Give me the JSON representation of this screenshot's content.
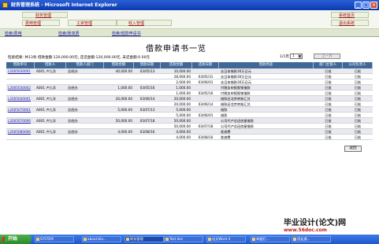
{
  "window": {
    "title": "财务管理系统 - Microsoft Internet Explorer"
  },
  "nav": {
    "row1": [
      "财务管理",
      "工资管理",
      "收入管理",
      "系统首页"
    ],
    "row2": [
      "费用管理",
      "退出系统"
    ]
  },
  "crumbs": [
    "检索/费用",
    "检索/账单费",
    "检索/借款申请书"
  ],
  "page_title": "借款申请书一览",
  "summary": "检索结果: 共13条  借款金额:120,000.00元, 还还金额:120,000.00元, 未还金额:0.00元",
  "pager": {
    "label": "1/1页",
    "selected": "1",
    "button": "上一页"
  },
  "table": {
    "headers": [
      "借款单号",
      "借款人",
      "借款人部门",
      "借款金额",
      "借款日期",
      "还款金额",
      "还款日期",
      "借款用途",
      "部门主管人",
      "公司负责人"
    ],
    "rows": [
      [
        "L2005030001",
        "A001 卢九洋",
        "总经办",
        "40,000.00",
        "03/05/13",
        "10,000.00",
        "",
        "去日本借款30万日元",
        "已批",
        "已批"
      ],
      [
        "",
        "",
        "",
        "",
        "",
        "28,000.00",
        "03/05/31",
        "去日本借款30万日元",
        "已批",
        "已批"
      ],
      [
        "",
        "",
        "",
        "",
        "",
        "2,000.00",
        "03/06/01",
        "去日本借款30万日元",
        "已批",
        "已批"
      ],
      [
        "L2005030002",
        "A001 卢九洋",
        "总经办",
        "1,000.00",
        "03/05/16",
        "1,000.00",
        "",
        "付税务申报报销借款",
        "已批",
        "已批"
      ],
      [
        "",
        "",
        "",
        "",
        "",
        "1,000.00",
        "03/05/16",
        "付税务申报报销借款",
        "已批",
        "已批"
      ],
      [
        "L2005040001",
        "A001 卢九洋",
        "总经办",
        "20,000.00",
        "03/06/14",
        "20,000.00",
        "",
        "借款还北京转账汇兑",
        "已批",
        "已批"
      ],
      [
        "",
        "",
        "",
        "",
        "",
        "20,000.00",
        "03/06/14",
        "借款还北京转账汇兑",
        "已批",
        "已批"
      ],
      [
        "L2005070001",
        "A001 卢九洋",
        "总经办",
        "5,000.00",
        "03/07/13",
        "5,000.00",
        "",
        "借款",
        "已批",
        "已批"
      ],
      [
        "",
        "",
        "",
        "",
        "",
        "5,000.00",
        "03/06/01",
        "借款",
        "已批",
        "已批"
      ],
      [
        "L2005070006",
        "A001 卢九洋",
        "总经办",
        "50,000.00",
        "03/07/18",
        "50,000.00",
        "",
        "公司代卢总还房屋借款",
        "已批",
        "已批"
      ],
      [
        "",
        "",
        "",
        "",
        "",
        "50,000.00",
        "03/07/18",
        "公司代卢总还房屋借款",
        "已批",
        "已批"
      ],
      [
        "L2005080006",
        "A001 卢九洋",
        "总经办",
        "4,000.00",
        "03/08/16",
        "4,000.00",
        "",
        "差旅费",
        "已批",
        "已批"
      ],
      [
        "",
        "",
        "",
        "",
        "",
        "4,000.00",
        "03/08/16",
        "差旅费",
        "已批",
        "已批"
      ]
    ]
  },
  "return_label": "返回",
  "taskbar": {
    "start": "开始",
    "tasks": [
      "SYSTEM",
      "about:bla...",
      "财务管理",
      "Test dev",
      "论文Word 4",
      "单据打...",
      "用友通..."
    ]
  },
  "banner": {
    "line1": "毕业设计(论文)网",
    "line2": "www.56doc.com"
  }
}
